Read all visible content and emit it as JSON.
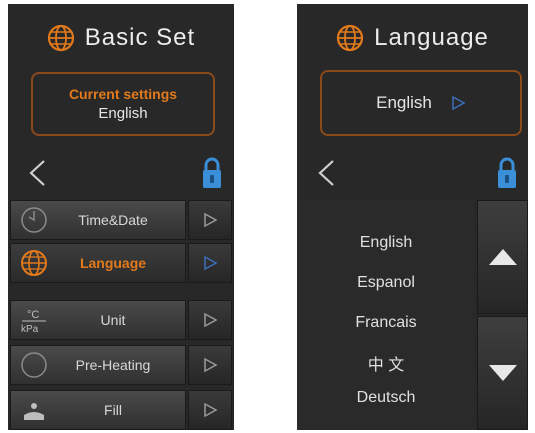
{
  "basic_set": {
    "title": "Basic Set",
    "current_settings": {
      "title": "Current settings",
      "value": "English"
    },
    "menu": [
      {
        "label": "Time&Date",
        "icon": "clock-icon",
        "active": false
      },
      {
        "label": "Language",
        "icon": "globe-icon",
        "active": true
      },
      {
        "label": "Unit",
        "icon": "temperature-kpa-icon",
        "active": false
      },
      {
        "label": "Pre-Heating",
        "icon": "circle-icon",
        "active": false
      },
      {
        "label": "Fill",
        "icon": "fill-icon",
        "active": false
      }
    ]
  },
  "language": {
    "title": "Language",
    "selected": "English",
    "options": [
      "English",
      "Espanol",
      "Francais",
      "中 文",
      "Deutsch"
    ]
  },
  "colors": {
    "accent": "#e27a1c",
    "lock": "#3a8fd8",
    "panel": "#282828"
  }
}
